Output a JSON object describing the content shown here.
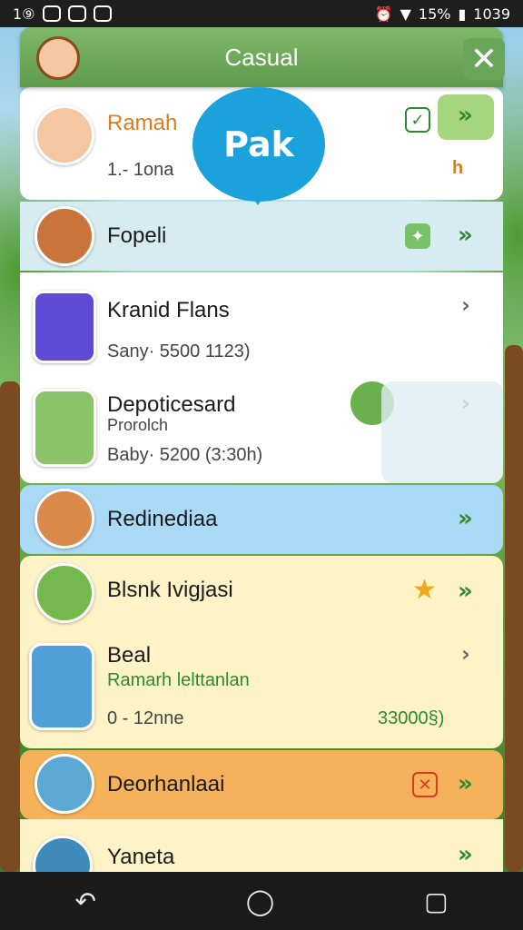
{
  "status_bar": {
    "left_text": "1⑨",
    "battery_text": "15%",
    "time": "1039"
  },
  "header": {
    "title": "Casual",
    "close_label": "✕"
  },
  "bubble": {
    "text": "Pak"
  },
  "rows": [
    {
      "name": "Ramah",
      "sub": "1.- 1ona",
      "badge": "h",
      "colors": {
        "bg": "#ffffff",
        "name": "#e07a1f"
      }
    },
    {
      "name": "Fopeli",
      "colors": {
        "bg": "#d7ecf0"
      }
    },
    {
      "name": "Kranid Flans",
      "sub": "Sany· 5500  1123)",
      "colors": {
        "bg": "#ffffff"
      }
    },
    {
      "name": "Depoticesard",
      "sub2": "Prorolch",
      "sub": "Baby· 5200  (3:30h)",
      "colors": {
        "bg": "#ffffff"
      }
    },
    {
      "name": "Redinediaa",
      "colors": {
        "bg": "#a9d9f5"
      }
    },
    {
      "name": "Blsnk Ivigjasi",
      "colors": {
        "bg": "#fdf3c6"
      }
    },
    {
      "name": "Beal",
      "sub2": "Ramarh lelttanlan",
      "sub": "0 - 12nne",
      "right_value": "33000§)",
      "colors": {
        "bg": "#fdf3c6"
      }
    },
    {
      "name": "Deorhanlaai",
      "colors": {
        "bg": "#f6b25a"
      }
    },
    {
      "name": "Yaneta",
      "colors": {
        "bg": "#fdf3c6"
      }
    }
  ],
  "nav": {
    "back": "↶",
    "home": "◯",
    "recents": "▢"
  },
  "icons": {
    "arrow": "»",
    "arrow_grey": "›",
    "star": "★",
    "close_box": "✕",
    "check": "✓"
  }
}
